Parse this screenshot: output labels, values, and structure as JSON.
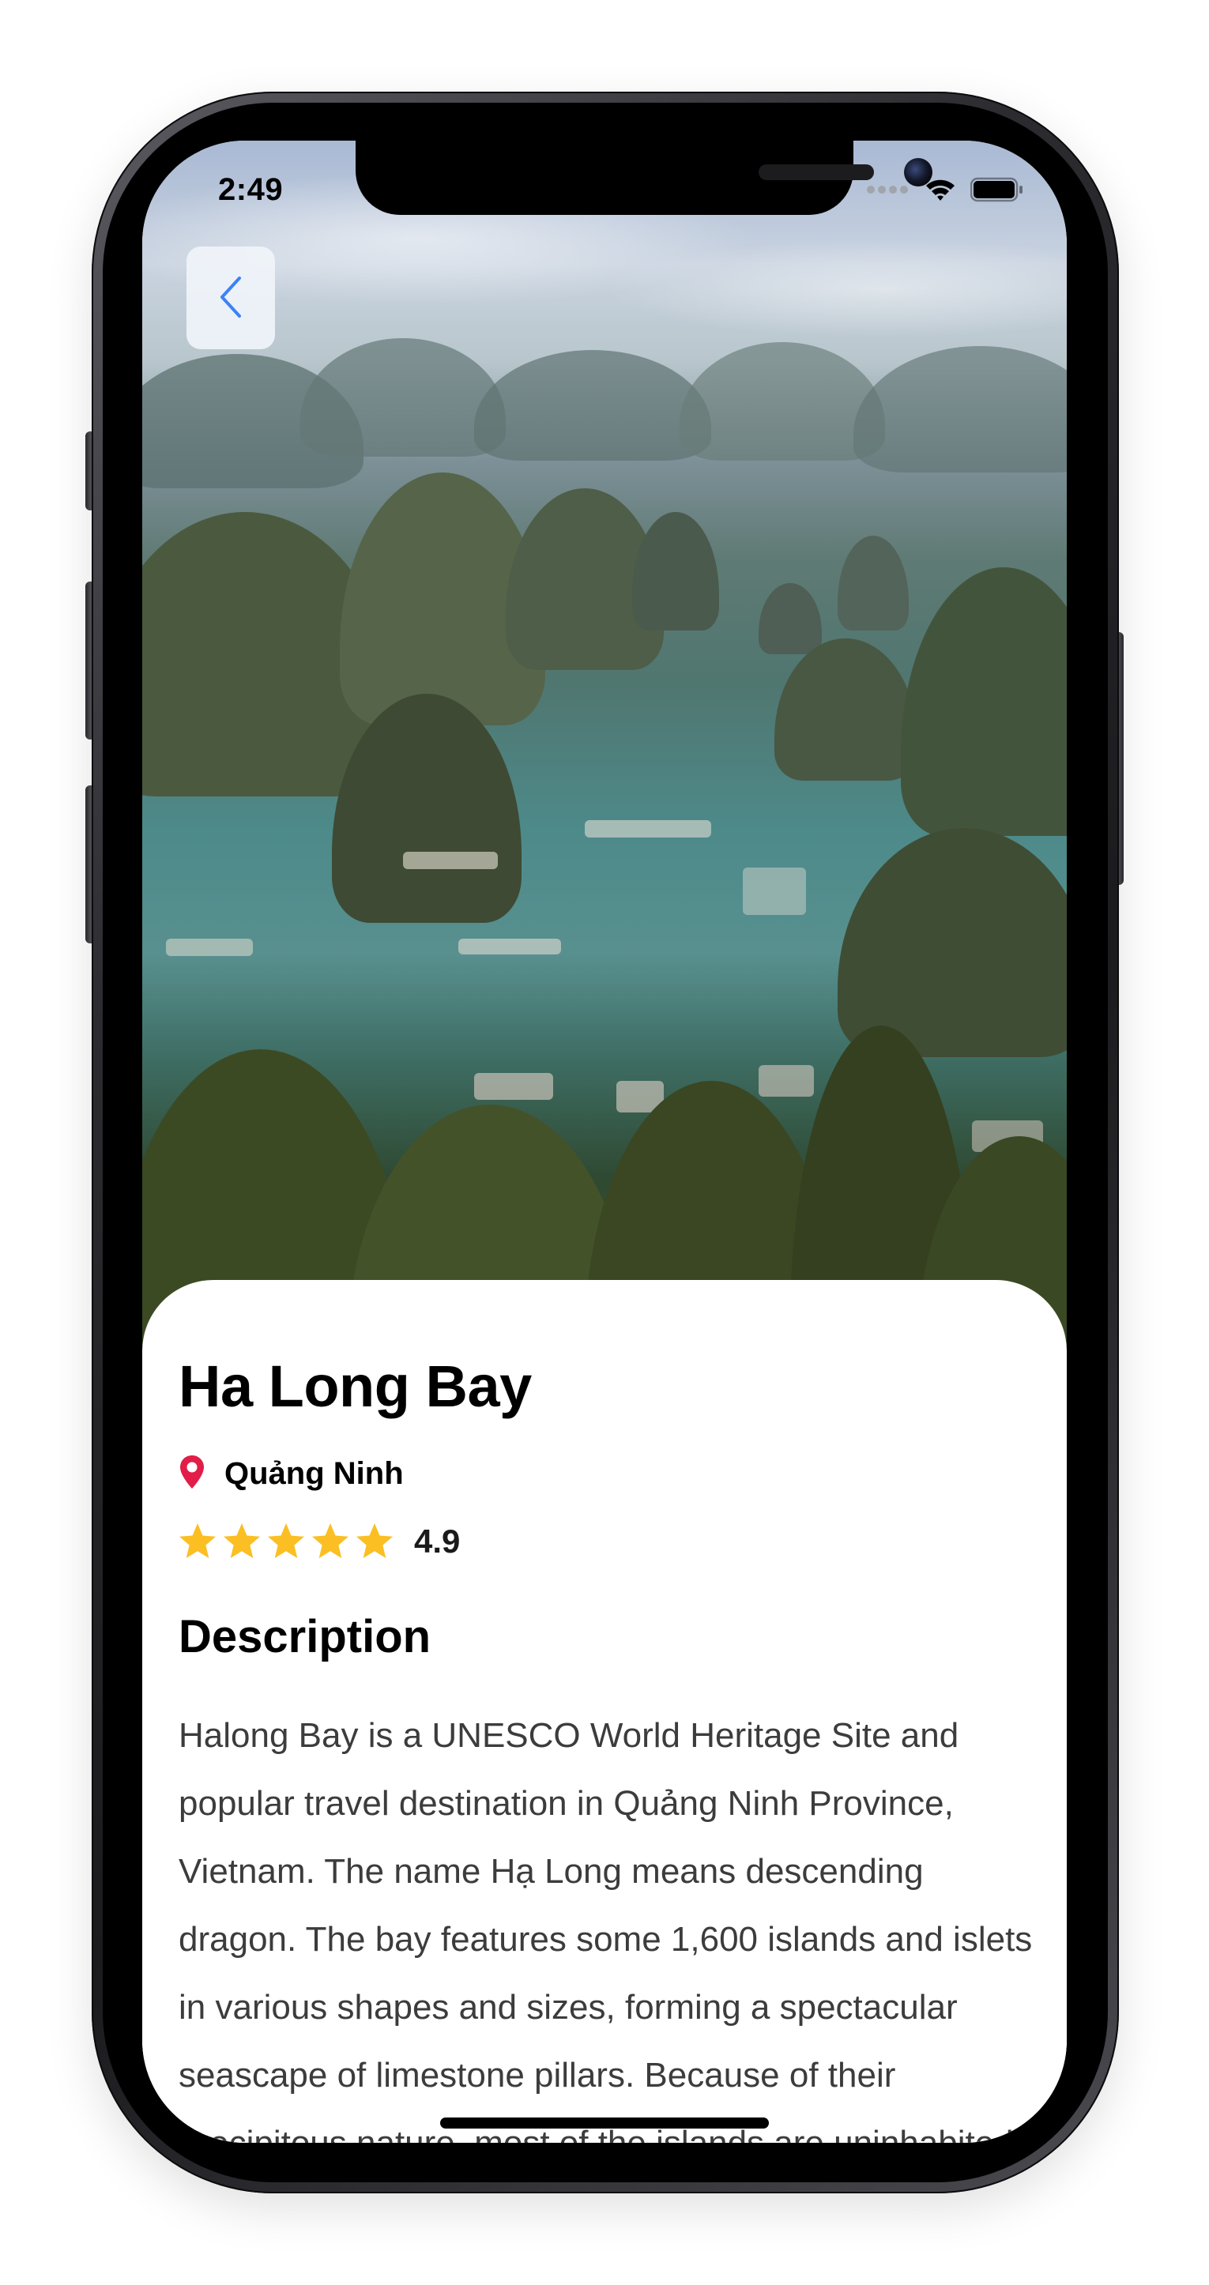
{
  "status_bar": {
    "time": "2:49",
    "signal_icon": "cellular-dots-icon",
    "wifi_icon": "wifi-icon",
    "battery_icon": "battery-icon"
  },
  "header": {
    "back_icon": "chevron-left-icon",
    "accent_color": "#3b82f6"
  },
  "place": {
    "name": "Ha Long Bay",
    "location": "Quảng Ninh",
    "location_icon": "map-pin-icon",
    "location_icon_color": "#e11d48",
    "rating": "4.9",
    "stars": 5,
    "star_color": "#fbbf24"
  },
  "description": {
    "title": "Description",
    "body": "Halong Bay is a UNESCO World Heritage Site and popular travel destination in Quảng Ninh Province, Vietnam. The name Hạ Long means descending dragon. The bay features some 1,600 islands and islets in various shapes and sizes, forming a spectacular seascape of limestone pillars. Because of their precipitous nature, most of the islands are uninhabited."
  }
}
